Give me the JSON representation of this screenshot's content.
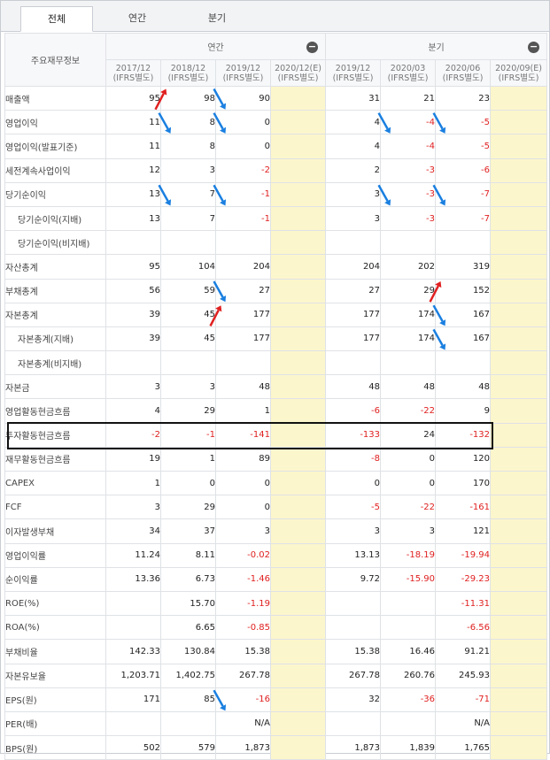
{
  "tabs": [
    {
      "label": "전체",
      "active": true
    },
    {
      "label": "연간",
      "active": false
    },
    {
      "label": "분기",
      "active": false
    }
  ],
  "corner_label": "주요재무정보",
  "groups": {
    "annual": "연간",
    "quarter": "분기"
  },
  "columns": [
    {
      "period": "2017/12",
      "basis": "(IFRS별도)"
    },
    {
      "period": "2018/12",
      "basis": "(IFRS별도)"
    },
    {
      "period": "2019/12",
      "basis": "(IFRS별도)"
    },
    {
      "period": "2020/12(E)",
      "basis": "(IFRS별도)"
    },
    {
      "period": "2019/12",
      "basis": "(IFRS별도)"
    },
    {
      "period": "2020/03",
      "basis": "(IFRS별도)"
    },
    {
      "period": "2020/06",
      "basis": "(IFRS별도)"
    },
    {
      "period": "2020/09(E)",
      "basis": "(IFRS별도)"
    }
  ],
  "rows": [
    {
      "label": "매출액",
      "indent": false,
      "values": [
        "95",
        "98",
        "90",
        "",
        "31",
        "21",
        "23",
        ""
      ]
    },
    {
      "label": "영업이익",
      "indent": false,
      "values": [
        "11",
        "8",
        "0",
        "",
        "4",
        "-4",
        "-5",
        ""
      ]
    },
    {
      "label": "영업이익(발표기준)",
      "indent": false,
      "values": [
        "11",
        "8",
        "0",
        "",
        "4",
        "-4",
        "-5",
        ""
      ]
    },
    {
      "label": "세전계속사업이익",
      "indent": false,
      "values": [
        "12",
        "3",
        "-2",
        "",
        "2",
        "-3",
        "-6",
        ""
      ]
    },
    {
      "label": "당기순이익",
      "indent": false,
      "values": [
        "13",
        "7",
        "-1",
        "",
        "3",
        "-3",
        "-7",
        ""
      ]
    },
    {
      "label": "당기순이익(지배)",
      "indent": true,
      "values": [
        "13",
        "7",
        "-1",
        "",
        "3",
        "-3",
        "-7",
        ""
      ]
    },
    {
      "label": "당기순이익(비지배)",
      "indent": true,
      "values": [
        "",
        "",
        "",
        "",
        "",
        "",
        "",
        ""
      ]
    },
    {
      "label": "자산총계",
      "indent": false,
      "values": [
        "95",
        "104",
        "204",
        "",
        "204",
        "202",
        "319",
        ""
      ]
    },
    {
      "label": "부채총계",
      "indent": false,
      "values": [
        "56",
        "59",
        "27",
        "",
        "27",
        "29",
        "152",
        ""
      ]
    },
    {
      "label": "자본총계",
      "indent": false,
      "values": [
        "39",
        "45",
        "177",
        "",
        "177",
        "174",
        "167",
        ""
      ]
    },
    {
      "label": "자본총계(지배)",
      "indent": true,
      "values": [
        "39",
        "45",
        "177",
        "",
        "177",
        "174",
        "167",
        ""
      ]
    },
    {
      "label": "자본총계(비지배)",
      "indent": true,
      "values": [
        "",
        "",
        "",
        "",
        "",
        "",
        "",
        ""
      ]
    },
    {
      "label": "자본금",
      "indent": false,
      "values": [
        "3",
        "3",
        "48",
        "",
        "48",
        "48",
        "48",
        ""
      ]
    },
    {
      "label": "영업활동현금흐름",
      "indent": false,
      "values": [
        "4",
        "29",
        "1",
        "",
        "-6",
        "-22",
        "9",
        ""
      ]
    },
    {
      "label": "투자활동현금흐름",
      "indent": false,
      "values": [
        "-2",
        "-1",
        "-141",
        "",
        "-133",
        "24",
        "-132",
        ""
      ]
    },
    {
      "label": "재무활동현금흐름",
      "indent": false,
      "values": [
        "19",
        "1",
        "89",
        "",
        "-8",
        "0",
        "120",
        ""
      ]
    },
    {
      "label": "CAPEX",
      "indent": false,
      "values": [
        "1",
        "0",
        "0",
        "",
        "0",
        "0",
        "170",
        ""
      ]
    },
    {
      "label": "FCF",
      "indent": false,
      "values": [
        "3",
        "29",
        "0",
        "",
        "-5",
        "-22",
        "-161",
        ""
      ]
    },
    {
      "label": "이자발생부채",
      "indent": false,
      "values": [
        "34",
        "37",
        "3",
        "",
        "3",
        "3",
        "121",
        ""
      ]
    },
    {
      "label": "영업이익률",
      "indent": false,
      "values": [
        "11.24",
        "8.11",
        "-0.02",
        "",
        "13.13",
        "-18.19",
        "-19.94",
        ""
      ]
    },
    {
      "label": "순이익률",
      "indent": false,
      "values": [
        "13.36",
        "6.73",
        "-1.46",
        "",
        "9.72",
        "-15.90",
        "-29.23",
        ""
      ]
    },
    {
      "label": "ROE(%)",
      "indent": false,
      "values": [
        "",
        "15.70",
        "-1.19",
        "",
        "",
        "",
        "-11.31",
        ""
      ]
    },
    {
      "label": "ROA(%)",
      "indent": false,
      "values": [
        "",
        "6.65",
        "-0.85",
        "",
        "",
        "",
        "-6.56",
        ""
      ]
    },
    {
      "label": "부채비율",
      "indent": false,
      "values": [
        "142.33",
        "130.84",
        "15.38",
        "",
        "15.38",
        "16.46",
        "91.21",
        ""
      ]
    },
    {
      "label": "자본유보율",
      "indent": false,
      "values": [
        "1,203.71",
        "1,402.75",
        "267.78",
        "",
        "267.78",
        "260.76",
        "245.93",
        ""
      ]
    },
    {
      "label": "EPS(원)",
      "indent": false,
      "values": [
        "171",
        "85",
        "-16",
        "",
        "32",
        "-36",
        "-71",
        ""
      ]
    },
    {
      "label": "PER(배)",
      "indent": false,
      "values": [
        "",
        "",
        "N/A",
        "",
        "",
        "",
        "N/A",
        ""
      ]
    },
    {
      "label": "BPS(원)",
      "indent": false,
      "values": [
        "502",
        "579",
        "1,873",
        "",
        "1,873",
        "1,839",
        "1,765",
        ""
      ]
    }
  ],
  "arrows": [
    {
      "row": 0,
      "col": 1,
      "dir": "up",
      "color": "#e02020"
    },
    {
      "row": 0,
      "col": 2,
      "dir": "down",
      "color": "#1a7fe0"
    },
    {
      "row": 1,
      "col": 1,
      "dir": "down",
      "color": "#1a7fe0"
    },
    {
      "row": 1,
      "col": 2,
      "dir": "down",
      "color": "#1a7fe0"
    },
    {
      "row": 1,
      "col": 5,
      "dir": "down",
      "color": "#1a7fe0"
    },
    {
      "row": 1,
      "col": 6,
      "dir": "down",
      "color": "#1a7fe0"
    },
    {
      "row": 4,
      "col": 1,
      "dir": "down",
      "color": "#1a7fe0"
    },
    {
      "row": 4,
      "col": 2,
      "dir": "down",
      "color": "#1a7fe0"
    },
    {
      "row": 4,
      "col": 5,
      "dir": "down",
      "color": "#1a7fe0"
    },
    {
      "row": 4,
      "col": 6,
      "dir": "down",
      "color": "#1a7fe0"
    },
    {
      "row": 8,
      "col": 2,
      "dir": "down",
      "color": "#1a7fe0"
    },
    {
      "row": 8,
      "col": 6,
      "dir": "up",
      "color": "#e02020"
    },
    {
      "row": 9,
      "col": 2,
      "dir": "up",
      "color": "#e02020"
    },
    {
      "row": 9,
      "col": 6,
      "dir": "down",
      "color": "#1a7fe0"
    },
    {
      "row": 10,
      "col": 6,
      "dir": "down",
      "color": "#1a7fe0"
    },
    {
      "row": 25,
      "col": 2,
      "dir": "down",
      "color": "#1a7fe0"
    }
  ],
  "highlight_row": 14,
  "colors": {
    "negative": "#e02020",
    "estimate_bg": "#fcf6cc",
    "up_arrow": "#e02020",
    "down_arrow": "#1a7fe0"
  }
}
